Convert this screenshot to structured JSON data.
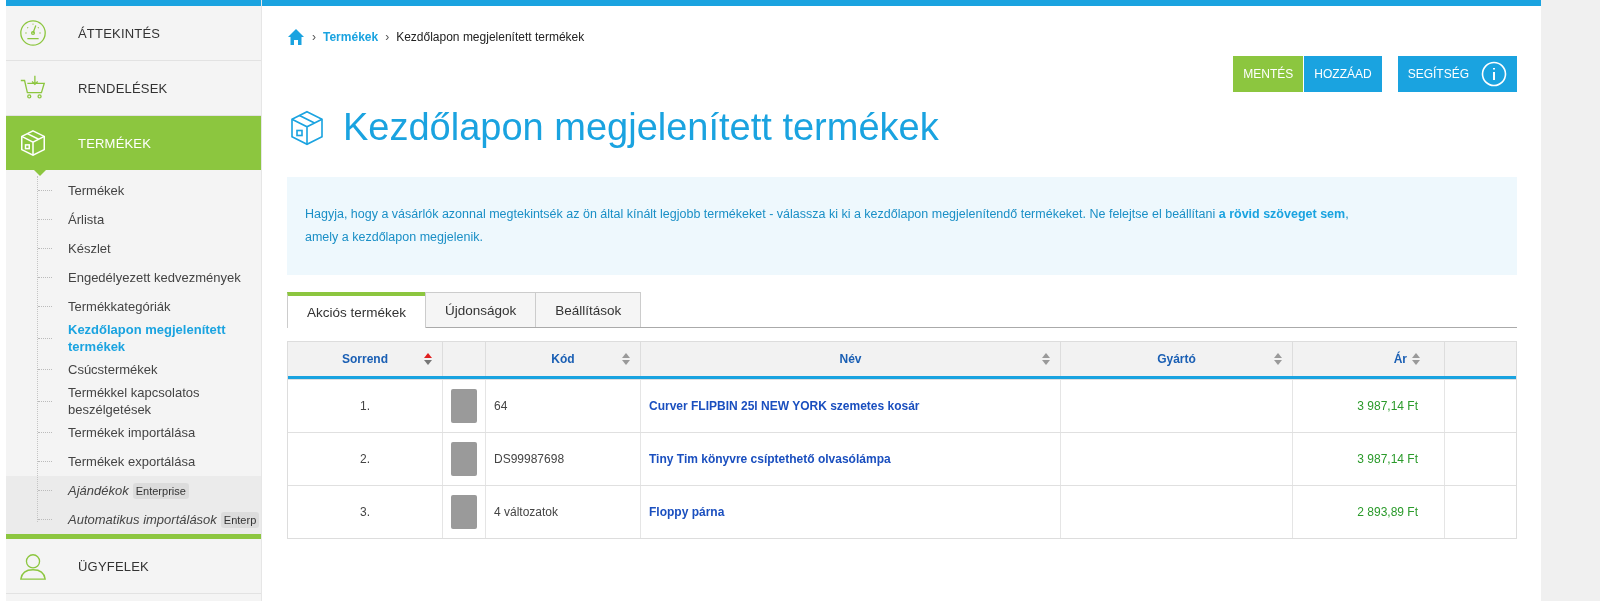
{
  "sidebar": {
    "items": [
      {
        "kind": "main",
        "label": "ÁTTEKINTÉS",
        "selected": false
      },
      {
        "kind": "main",
        "label": "RENDELÉSEK",
        "selected": false
      },
      {
        "kind": "main",
        "label": "TERMÉKEK",
        "selected": true,
        "children": [
          {
            "label": "Termékek",
            "selected": false
          },
          {
            "label": "Árlista",
            "selected": false
          },
          {
            "label": "Készlet",
            "selected": false
          },
          {
            "label": "Engedélyezett kedvezmények",
            "selected": false
          },
          {
            "label": "Termékkategóriák",
            "selected": false
          },
          {
            "label": "Kezdőlapon megjelenített termékek",
            "selected": true
          },
          {
            "label": "Csúcstermékek",
            "selected": false
          },
          {
            "label": "Termékkel kapcsolatos beszélgetések",
            "selected": false
          },
          {
            "label": "Termékek importálása",
            "selected": false
          },
          {
            "label": "Termékek exportálása",
            "selected": false
          },
          {
            "label": "Ajándékok",
            "selected": false,
            "badge": "Enterprise"
          },
          {
            "label": "Automatikus importálások",
            "selected": false,
            "badge": "Enterp"
          }
        ]
      },
      {
        "kind": "main",
        "label": "ÜGYFELEK",
        "selected": false
      }
    ]
  },
  "breadcrumb": [
    {
      "separator": "›",
      "label": "Termékek",
      "link": true
    },
    {
      "separator": "›",
      "label": "Kezdőlapon megjelenített termékek",
      "link": false
    }
  ],
  "buttons": [
    {
      "label": "MENTÉS",
      "kind": "save"
    },
    {
      "label": "HOZZÁAD",
      "kind": "add"
    },
    {
      "label": "SEGÍTSÉG",
      "kind": "help"
    }
  ],
  "title": "Kezdőlapon megjelenített termékek",
  "info": "Hagyja, hogy a vásárlók azonnal megtekintsék az ön által kínált legjobb termékeket - válassza ki ki a kezdőlapon megjelenítendő termékeket. Ne felejtse el beállítani **a rövid szöveget sem**, amely a kezdőlapon megjelenik.",
  "tabs": [
    {
      "label": "Akciós termékek",
      "selected": true
    },
    {
      "label": "Újdonságok",
      "selected": false
    },
    {
      "label": "Beállítások",
      "selected": false
    }
  ],
  "table": {
    "columns": [
      {
        "label": "Sorrend",
        "sorted": true
      },
      {
        "label": "Kód",
        "sorted": false
      },
      {
        "label": "Név",
        "sorted": false
      },
      {
        "label": "Gyártó",
        "sorted": false
      },
      {
        "label": "Ár",
        "sorted": false
      }
    ],
    "rows": [
      {
        "order": "1.",
        "code": "64",
        "name": "Curver FLIPBIN 25l NEW YORK szemetes kosár",
        "price": "3 987,14 Ft"
      },
      {
        "order": "2.",
        "code": "DS99987698",
        "name": "Tiny Tim könyvre csíptethető olvasólámpa",
        "price": "3 987,14 Ft"
      },
      {
        "order": "3.",
        "code": "4 változatok",
        "name": "Floppy párna",
        "price": "2 893,89 Ft"
      }
    ]
  }
}
